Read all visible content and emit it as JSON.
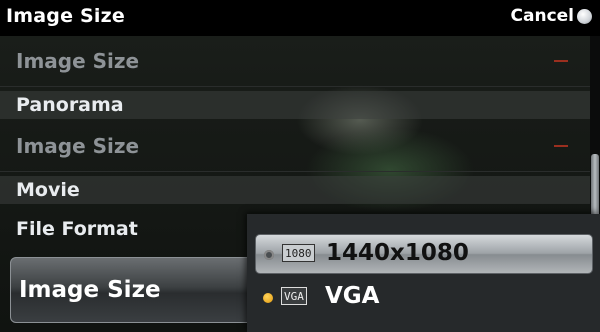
{
  "header": {
    "title": "Image Size",
    "cancel_label": "Cancel"
  },
  "menu": {
    "rows": [
      {
        "label": "Image Size",
        "state": "disabled",
        "value": "–"
      },
      {
        "label": "Panorama",
        "state": "section"
      },
      {
        "label": "Image Size",
        "state": "disabled",
        "value": "–"
      },
      {
        "label": "Movie",
        "state": "section"
      },
      {
        "label": "File Format",
        "state": "normal"
      }
    ],
    "selected_item_label": "Image Size"
  },
  "popup": {
    "options": [
      {
        "badge": "1080",
        "label": "1440x1080",
        "selected": true
      },
      {
        "badge": "VGA",
        "label": "VGA",
        "selected": false
      }
    ]
  },
  "colors": {
    "accent_dot": "#f0a818",
    "disabled_text": "#8e9397",
    "dash": "#9b2f1f"
  }
}
